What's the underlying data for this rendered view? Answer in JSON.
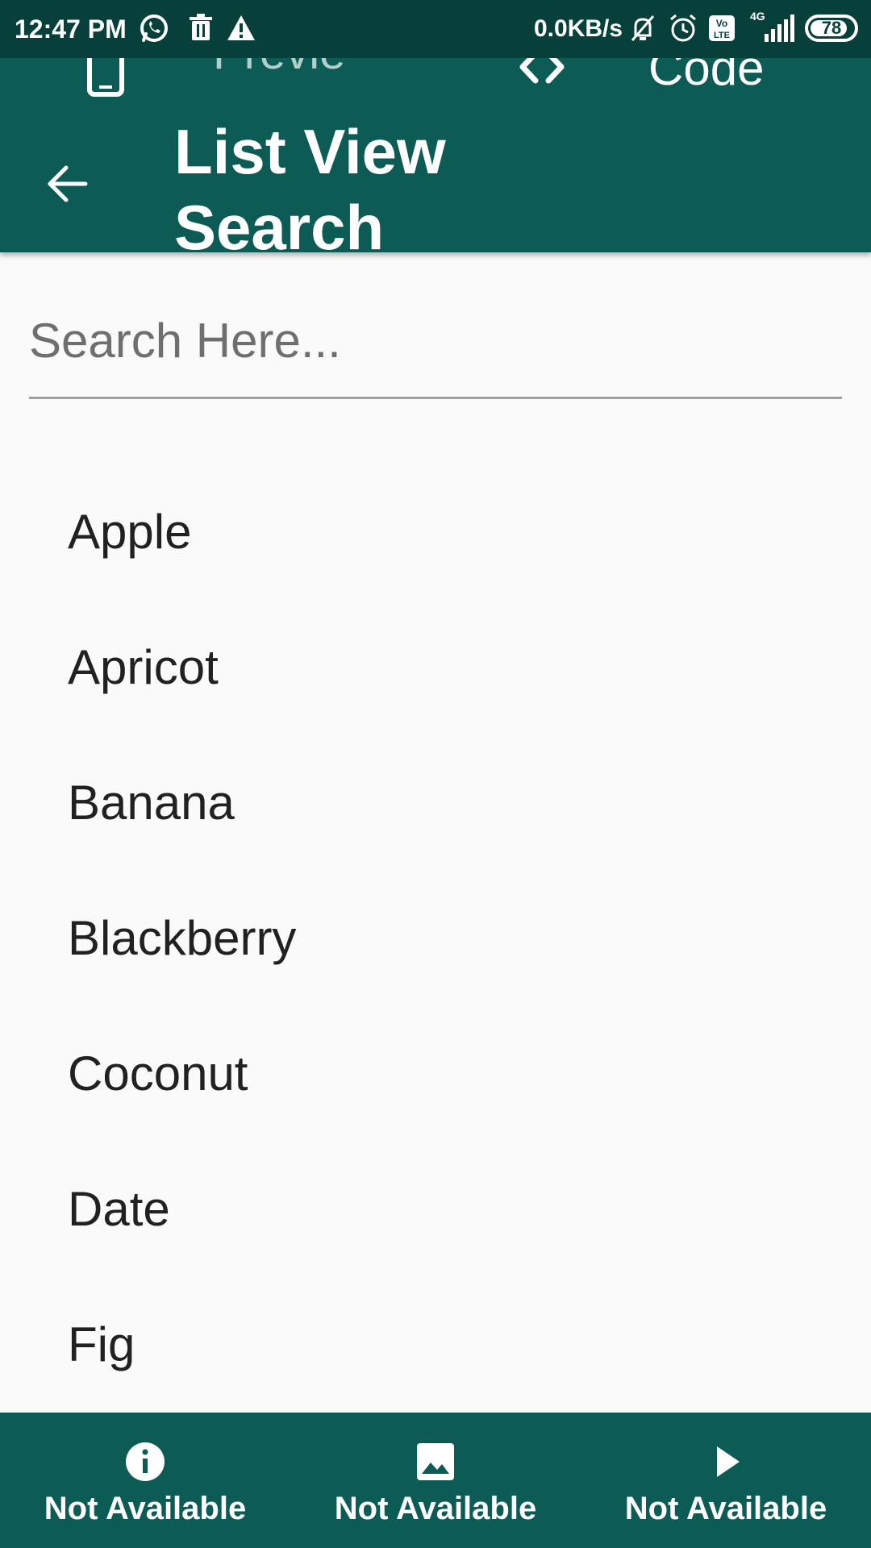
{
  "status_bar": {
    "time": "12:47 PM",
    "network_speed": "0.0KB/s",
    "network_type": "4G",
    "battery_level": "78",
    "icons": [
      "whatsapp-icon",
      "trash-icon",
      "warning-icon",
      "muted-bell-icon",
      "alarm-icon",
      "volte-icon",
      "signal-icon",
      "battery-icon"
    ]
  },
  "tabs": {
    "preview_label": "Preview",
    "code_label": "Code",
    "preview_icon": "phone-icon",
    "code_icon": "code-brackets-icon"
  },
  "appbar": {
    "title": "List View Search",
    "back_icon": "arrow-back-icon"
  },
  "search": {
    "placeholder": "Search Here...",
    "value": ""
  },
  "list": {
    "items": [
      "Apple",
      "Apricot",
      "Banana",
      "Blackberry",
      "Coconut",
      "Date",
      "Fig"
    ]
  },
  "bottom_nav": {
    "items": [
      {
        "label": "Not Available",
        "icon": "info-icon"
      },
      {
        "label": "Not Available",
        "icon": "image-icon"
      },
      {
        "label": "Not Available",
        "icon": "play-icon"
      }
    ]
  },
  "colors": {
    "primary": "#0c5c55",
    "status_bar": "#07403b",
    "background": "#fafafa",
    "text": "#212121"
  }
}
